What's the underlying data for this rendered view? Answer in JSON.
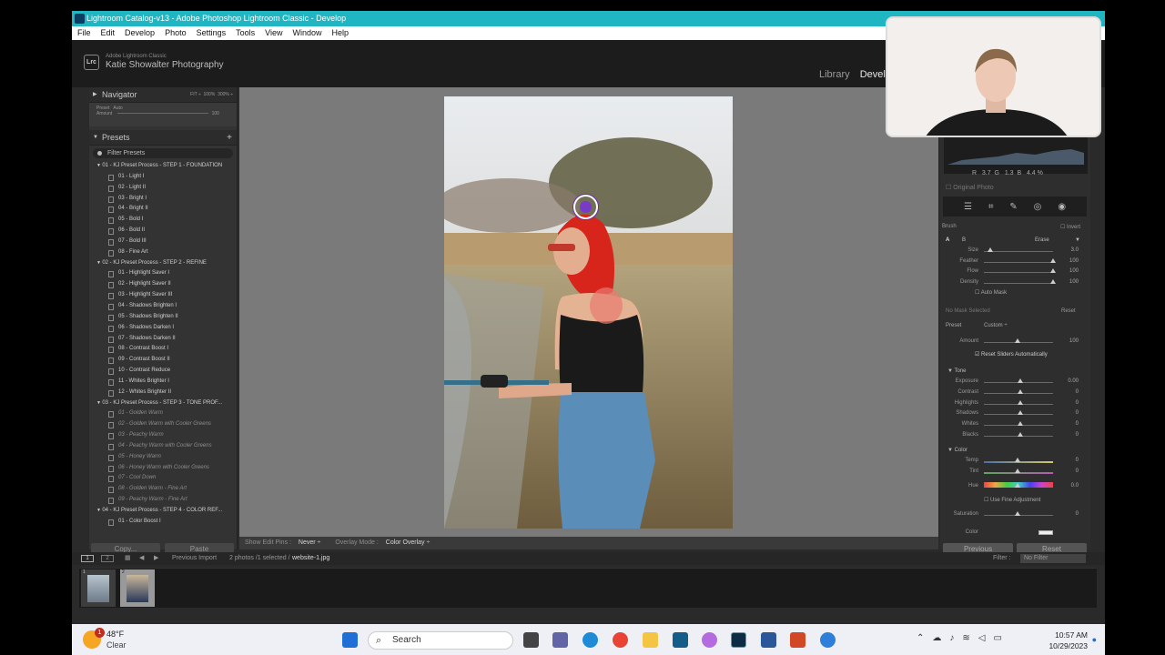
{
  "window": {
    "title": "Lightroom Catalog-v13 - Adobe Photoshop Lightroom Classic - Develop"
  },
  "menu": [
    "File",
    "Edit",
    "Develop",
    "Photo",
    "Settings",
    "Tools",
    "View",
    "Window",
    "Help"
  ],
  "identity": {
    "logo": "Lrc",
    "app_name": "Adobe Lightroom Classic",
    "studio": "Katie Showalter Photography"
  },
  "modules": {
    "library": "Library",
    "develop": "Develop"
  },
  "navigator": {
    "title": "Navigator",
    "opts": [
      "FIT ÷",
      "100%",
      "300% ÷"
    ],
    "preset_label": "Preset",
    "preset_value": "Auto",
    "amount_label": "Amount",
    "amount_value": "100"
  },
  "presets": {
    "title": "Presets",
    "add": "+",
    "filter": "Filter Presets",
    "groups": [
      {
        "name": "01 - KJ Preset Process - STEP 1 - FOUNDATION",
        "items": [
          "01 - Light I",
          "02 - Light II",
          "03 - Bright I",
          "04 - Bright II",
          "05 - Bold I",
          "06 - Bold II",
          "07 - Bold III",
          "08 - Fine Art"
        ],
        "dim": false
      },
      {
        "name": "02 - KJ Preset Process - STEP 2 - REFINE",
        "items": [
          "01 - Highlight Saver I",
          "02 - Highlight Saver II",
          "03 - Highlight Saver III",
          "04 - Shadows Brighten I",
          "05 - Shadows Brighten II",
          "06 - Shadows Darken I",
          "07 - Shadows Darken II",
          "08 - Contrast Boost I",
          "09 - Contrast Boost II",
          "10 - Contrast Reduce",
          "11 - Whites Brighter I",
          "12 - Whites Brighter II"
        ],
        "dim": false
      },
      {
        "name": "03 - KJ Preset Process - STEP 3 - TONE PROF...",
        "items": [
          "01 - Golden Warm",
          "02 - Golden Warm with Cooler Greens",
          "03 - Peachy Warm",
          "04 - Peachy Warm with Cooler Greens",
          "05 - Honey Warm",
          "06 - Honey Warm with Cooler Greens",
          "07 - Cool Down",
          "08 - Golden Warm - Fine Art",
          "09 - Peachy Warm - Fine Art"
        ],
        "dim": true
      },
      {
        "name": "04 - KJ Preset Process - STEP 4 - COLOR REF...",
        "items": [
          "01 - Color Boost I"
        ],
        "dim": false
      }
    ]
  },
  "left_buttons": {
    "copy": "Copy...",
    "paste": "Paste"
  },
  "toolbar": {
    "show_edit_pins": "Show Edit Pins :",
    "pins_value": "Never ÷",
    "overlay_mode": "Overlay Mode :",
    "overlay_value": "Color Overlay ÷"
  },
  "histogram": {
    "r": "R",
    "r_val": "3.7",
    "g": "G",
    "g_val": "1.3",
    "b": "B",
    "b_val": "4.4",
    "pct": "%"
  },
  "original_photo": "Original Photo",
  "brush": {
    "title": "Brush",
    "invert": "Invert",
    "a": "A",
    "b": "B",
    "erase": "Erase",
    "sliders": [
      {
        "label": "Size",
        "value": "3.0",
        "pos": 0.05
      },
      {
        "label": "Feather",
        "value": "100",
        "pos": 1.0
      },
      {
        "label": "Flow",
        "value": "100",
        "pos": 1.0
      },
      {
        "label": "Density",
        "value": "100",
        "pos": 1.0
      }
    ],
    "auto_mask": "Auto Mask"
  },
  "mask": {
    "none": "No Mask Selected",
    "reset": "Reset",
    "preset_label": "Preset",
    "preset_value": "Custom ÷",
    "amount_label": "Amount",
    "amount_value": "100",
    "reset_auto": "Reset Sliders Automatically"
  },
  "tone": {
    "title": "Tone",
    "sliders": [
      {
        "label": "Exposure",
        "value": "0.00"
      },
      {
        "label": "Contrast",
        "value": "0"
      },
      {
        "label": "Highlights",
        "value": "0"
      },
      {
        "label": "Shadows",
        "value": "0"
      },
      {
        "label": "Whites",
        "value": "0"
      },
      {
        "label": "Blacks",
        "value": "0"
      }
    ]
  },
  "color": {
    "title": "Color",
    "temp": "Temp",
    "temp_val": "0",
    "tint": "Tint",
    "tint_val": "0",
    "hue": "Hue",
    "hue_val": "0.0",
    "fine": "Use Fine Adjustment",
    "saturation": "Saturation",
    "sat_val": "0",
    "color": "Color"
  },
  "right_buttons": {
    "previous": "Previous",
    "reset": "Reset"
  },
  "filmbar": {
    "prev_import": "Previous Import",
    "summary": "2 photos /1 selected /",
    "filename": "website-1.jpg",
    "filter": "Filter :",
    "filter_value": "No Filter"
  },
  "filmstrip": {
    "thumbs": [
      "1",
      "2"
    ]
  },
  "taskbar": {
    "temp": "48°F",
    "condition": "Clear",
    "badge": "1",
    "search": "Search",
    "time": "10:57 AM",
    "date": "10/29/2023"
  }
}
